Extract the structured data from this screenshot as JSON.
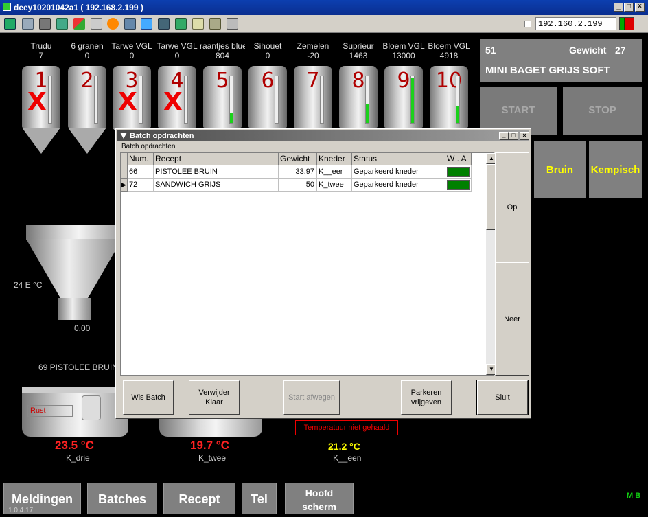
{
  "window": {
    "title": "deey10201042a1 ( 192.168.2.199 )"
  },
  "toolbar": {
    "ip_value": "192.160.2.199"
  },
  "silos": [
    {
      "label": "Trudu",
      "value": "7",
      "num": "1",
      "x": true,
      "level": 0
    },
    {
      "label": "6 granen",
      "value": "0",
      "num": "2",
      "x": false,
      "level": 0
    },
    {
      "label": "Tarwe VGL",
      "value": "0",
      "num": "3",
      "x": true,
      "level": 0
    },
    {
      "label": "Tarwe VGL",
      "value": "0",
      "num": "4",
      "x": true,
      "level": 0
    },
    {
      "label": "raantjes blue",
      "value": "804",
      "num": "5",
      "x": false,
      "level": 0.2
    },
    {
      "label": "Sihouet",
      "value": "0",
      "num": "6",
      "x": false,
      "level": 0
    },
    {
      "label": "Zemelen",
      "value": "-20",
      "num": "7",
      "x": false,
      "level": 0
    },
    {
      "label": "Suprieur",
      "value": "1463",
      "num": "8",
      "x": false,
      "level": 0.4
    },
    {
      "label": "Bloem VGL",
      "value": "13000",
      "num": "9",
      "x": false,
      "level": 0.95
    },
    {
      "label": "Bloem VGL",
      "value": "4918",
      "num": "10",
      "x": false,
      "level": 0.35
    }
  ],
  "recipe_panel": {
    "number": "51",
    "weight_label": "Gewicht",
    "weight": "27",
    "name": "MINI BAGET GRIJS SOFT"
  },
  "controls": {
    "start": "START",
    "stop": "STOP",
    "bruin": "Bruin",
    "kempisch": "Kempisch"
  },
  "hopper": {
    "temp_label": "24 E °C",
    "weight": "0.00",
    "current_batch": "69 PISTOLEE BRUIN"
  },
  "kneaders": [
    {
      "status": "Rust",
      "temp": "23.5 °C",
      "name": "K_drie"
    },
    {
      "temp": "19.7 °C",
      "name": "K_twee"
    },
    {
      "alert": "Temperatuur niet gehaald",
      "temp": "21.2 °C",
      "name": "K__een"
    }
  ],
  "nav": {
    "meldingen": "Meldingen",
    "batches": "Batches",
    "recept": "Recept",
    "tel": "Tel",
    "hoofd": "Hoofd",
    "scherm": "scherm",
    "version": "1.0.4.17",
    "initials": "M B"
  },
  "dialog": {
    "title": "Batch opdrachten",
    "group_label": "Batch opdrachten",
    "columns": [
      "Num.",
      "Recept",
      "Gewicht",
      "Kneder",
      "Status",
      "W . A"
    ],
    "rows": [
      {
        "num": "66",
        "recept": "PISTOLEE BRUIN",
        "gewicht": "33.97",
        "kneder": "K__eer",
        "status": "Geparkeerd kneder",
        "selected": false
      },
      {
        "num": "72",
        "recept": "SANDWICH GRIJS",
        "gewicht": "50",
        "kneder": "K_twee",
        "status": "Geparkeerd kneder",
        "selected": true
      }
    ],
    "up_label": "Op",
    "down_label": "Neer",
    "buttons": {
      "wis_batch": "Wis Batch",
      "verwijder_l1": "Verwijder",
      "verwijder_l2": "Klaar",
      "start_afwegen": "Start afwegen",
      "parkeren_l1": "Parkeren",
      "parkeren_l2": "vrijgeven",
      "sluit": "Sluit"
    }
  },
  "colors": {
    "status_green": "#008000",
    "temp_red": "#ff2020",
    "temp_yellow": "#ffff00",
    "accent_yellow": "#ffff00"
  }
}
